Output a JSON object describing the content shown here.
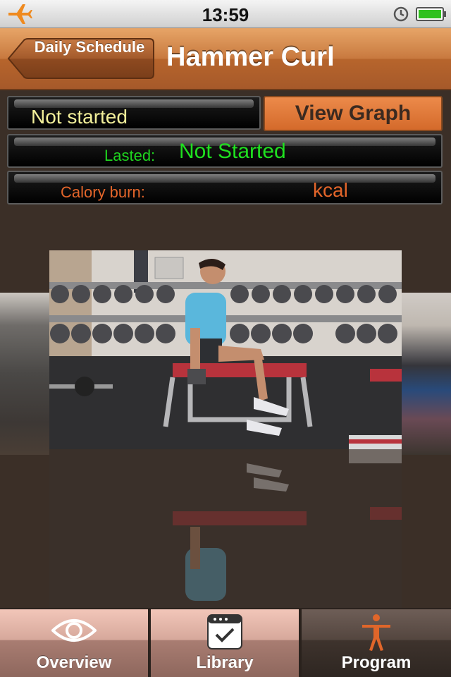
{
  "status_bar": {
    "time": "13:59"
  },
  "nav": {
    "back_label": "Daily Schedule",
    "title": "Hammer Curl"
  },
  "info": {
    "status": "Not started",
    "view_graph_label": "View Graph",
    "lasted_label": "Lasted:",
    "lasted_value": "Not Started",
    "calory_label": "Calory burn:",
    "calory_unit": "kcal"
  },
  "tabs": [
    {
      "label": "Overview",
      "icon": "eye-icon",
      "active": false
    },
    {
      "label": "Library",
      "icon": "checklist-icon",
      "active": false
    },
    {
      "label": "Program",
      "icon": "person-icon",
      "active": true
    }
  ],
  "colors": {
    "nav_orange": "#c8793f",
    "graph_button": "#e17a3a",
    "lasted_green": "#1fe01f",
    "calory_orange": "#e3652a",
    "status_yellow": "#f2ef9a",
    "background": "#3b2f27"
  }
}
